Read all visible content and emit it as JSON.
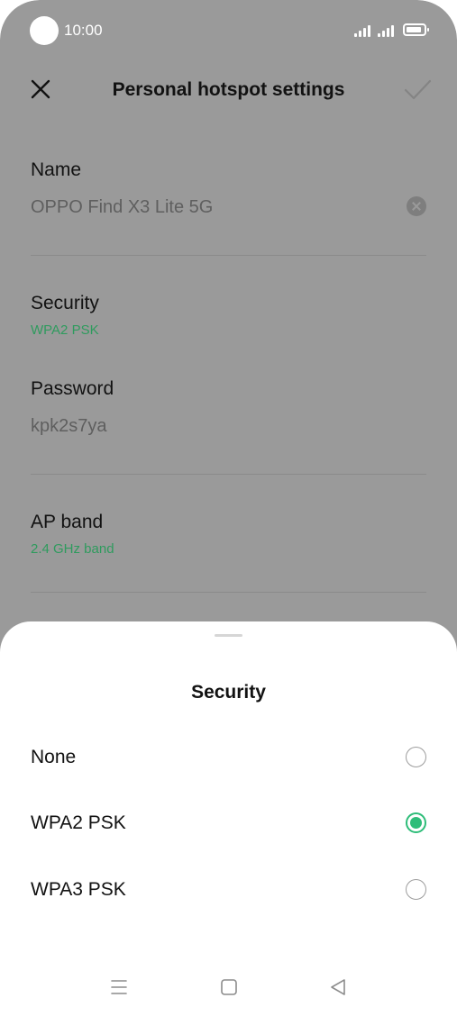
{
  "status_bar": {
    "time": "10:00"
  },
  "header": {
    "title": "Personal hotspot settings",
    "close_icon": "close-icon",
    "confirm_icon": "checkmark-icon"
  },
  "fields": {
    "name": {
      "label": "Name",
      "value": "OPPO Find X3 Lite 5G"
    },
    "security": {
      "label": "Security",
      "value": "WPA2 PSK"
    },
    "password": {
      "label": "Password",
      "value": "kpk2s7ya"
    },
    "ap_band": {
      "label": "AP band",
      "value": "2.4 GHz band"
    }
  },
  "sheet": {
    "title": "Security",
    "options": [
      {
        "label": "None",
        "selected": false
      },
      {
        "label": "WPA2 PSK",
        "selected": true
      },
      {
        "label": "WPA3 PSK",
        "selected": false
      }
    ]
  },
  "colors": {
    "accent": "#2ebd79",
    "value_green": "#2f9b5e",
    "scrim": "#9a9a9a"
  },
  "navbar": {
    "icons": [
      "menu-icon",
      "home-square-icon",
      "back-triangle-icon"
    ]
  }
}
